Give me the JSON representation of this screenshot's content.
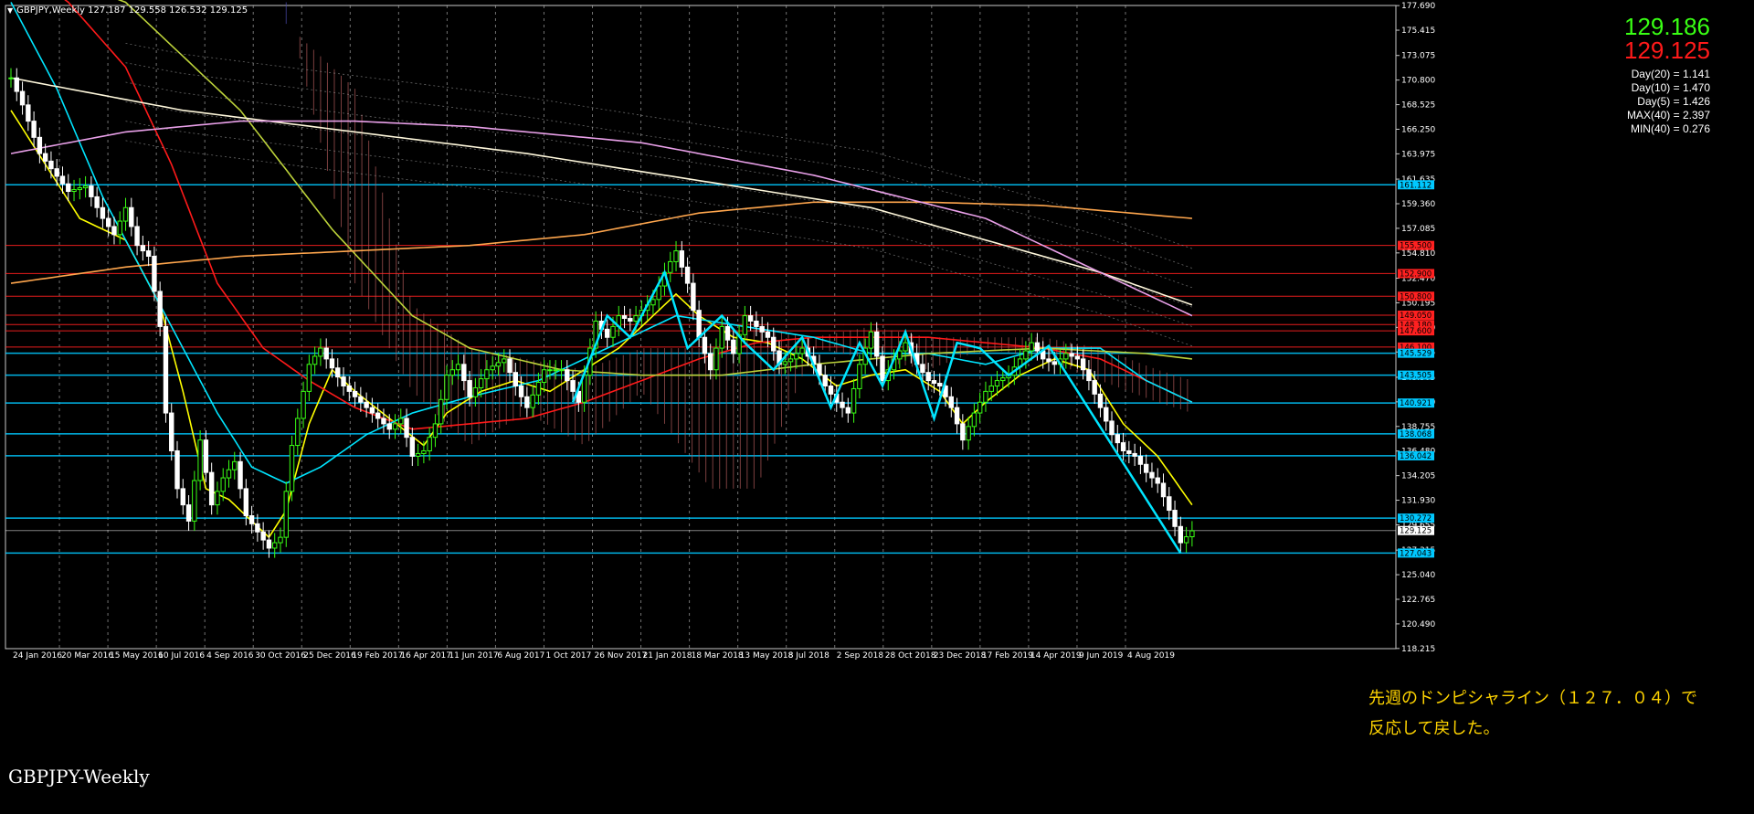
{
  "header": {
    "text": "GBPJPY,Weekly  127.187 129.558 126.532 129.125"
  },
  "prices": {
    "bid": "129.186",
    "ask": "129.125"
  },
  "stats": [
    "Day(20) = 1.141",
    "Day(10) = 1.470",
    "Day(5) = 1.426",
    "MAX(40) = 2.397",
    "MIN(40) = 0.276"
  ],
  "annotation": {
    "line1": "先週のドンピシャライン（１２７．０４）で",
    "line2": "反応して戻した。"
  },
  "watermark": "GBPJPY-Weekly",
  "chart_data": {
    "type": "line",
    "symbol": "GBPJPY",
    "timeframe": "Weekly",
    "ylim": [
      118.2,
      177.7
    ],
    "y_ticks": [
      "177.690",
      "175.415",
      "173.075",
      "170.800",
      "168.525",
      "166.250",
      "163.975",
      "161.635",
      "159.360",
      "157.085",
      "154.810",
      "152.470",
      "150.195",
      "147.920",
      "145.645",
      "143.305",
      "141.030",
      "138.755",
      "136.480",
      "134.205",
      "131.930",
      "129.655",
      "127.315",
      "125.040",
      "122.765",
      "120.490",
      "118.215"
    ],
    "x_ticks": [
      "24 Jan 2016",
      "20 Mar 2016",
      "15 May 2016",
      "10 Jul 2016",
      "4 Sep 2016",
      "30 Oct 2016",
      "25 Dec 2016",
      "19 Feb 2017",
      "16 Apr 2017",
      "11 Jun 2017",
      "6 Aug 2017",
      "1 Oct 2017",
      "26 Nov 2017",
      "21 Jan 2018",
      "18 Mar 2018",
      "13 May 2018",
      "8 Jul 2018",
      "2 Sep 2018",
      "28 Oct 2018",
      "23 Dec 2018",
      "17 Feb 2019",
      "14 Apr 2019",
      "9 Jun 2019",
      "4 Aug 2019"
    ],
    "price_line_labels": [
      {
        "value": 161.112,
        "text": "161.112",
        "color": "#00c8ff"
      },
      {
        "value": 155.5,
        "text": "155.500",
        "color": "#ff2020"
      },
      {
        "value": 152.9,
        "text": "152.900",
        "color": "#ff2020"
      },
      {
        "value": 150.8,
        "text": "150.800",
        "color": "#ff2020"
      },
      {
        "value": 149.05,
        "text": "149.050",
        "color": "#ff2020"
      },
      {
        "value": 148.18,
        "text": "148.180",
        "color": "#ff2020"
      },
      {
        "value": 147.6,
        "text": "147.600",
        "color": "#ff2020"
      },
      {
        "value": 146.1,
        "text": "146.100",
        "color": "#ff2020"
      },
      {
        "value": 145.529,
        "text": "145.529",
        "color": "#00c8ff"
      },
      {
        "value": 143.505,
        "text": "143.505",
        "color": "#00c8ff"
      },
      {
        "value": 140.921,
        "text": "140.921",
        "color": "#00c8ff"
      },
      {
        "value": 138.068,
        "text": "138.068",
        "color": "#00c8ff"
      },
      {
        "value": 136.042,
        "text": "136.042",
        "color": "#00c8ff"
      },
      {
        "value": 130.272,
        "text": "130.272",
        "color": "#00c8ff"
      },
      {
        "value": 129.125,
        "text": "129.125",
        "color": "#ffffff"
      },
      {
        "value": 127.043,
        "text": "127.043",
        "color": "#00c8ff"
      }
    ],
    "series": [
      {
        "type": "candlestick",
        "color_up": "#39ff14",
        "color_down": "#ffffff",
        "anchors": [
          [
            0,
            171
          ],
          [
            2,
            168.5
          ],
          [
            5,
            164
          ],
          [
            10,
            160.5
          ],
          [
            13,
            161
          ],
          [
            16,
            158
          ],
          [
            18,
            156.5
          ],
          [
            20,
            159
          ],
          [
            22,
            155.5
          ],
          [
            24,
            154.5
          ],
          [
            26,
            148
          ],
          [
            27,
            140
          ],
          [
            29,
            133
          ],
          [
            31,
            130
          ],
          [
            33,
            137.5
          ],
          [
            35,
            131.5
          ],
          [
            37,
            134
          ],
          [
            39,
            135.5
          ],
          [
            41,
            130.5
          ],
          [
            43,
            129
          ],
          [
            45,
            127.5
          ],
          [
            47,
            128.5
          ],
          [
            49,
            137
          ],
          [
            52,
            144.5
          ],
          [
            54,
            146
          ],
          [
            55,
            145
          ],
          [
            58,
            142.5
          ],
          [
            60,
            141.5
          ],
          [
            62,
            140.5
          ],
          [
            64,
            139.5
          ],
          [
            66,
            138.5
          ],
          [
            68,
            139.5
          ],
          [
            70,
            136
          ],
          [
            72,
            136.5
          ],
          [
            74,
            139
          ],
          [
            76,
            143.5
          ],
          [
            78,
            144.5
          ],
          [
            80,
            141.5
          ],
          [
            83,
            144
          ],
          [
            86,
            145
          ],
          [
            88,
            142.5
          ],
          [
            90,
            140.5
          ],
          [
            93,
            144
          ],
          [
            96,
            144
          ],
          [
            99,
            141
          ],
          [
            102,
            148.5
          ],
          [
            104,
            147
          ],
          [
            106,
            149
          ],
          [
            108,
            148.5
          ],
          [
            110,
            149.5
          ],
          [
            112,
            150.5
          ],
          [
            114,
            153
          ],
          [
            116,
            155
          ],
          [
            118,
            152
          ],
          [
            120,
            147
          ],
          [
            122,
            144
          ],
          [
            124,
            148
          ],
          [
            126,
            145.5
          ],
          [
            128,
            149
          ],
          [
            130,
            148
          ],
          [
            132,
            147
          ],
          [
            134,
            144.5
          ],
          [
            136,
            145
          ],
          [
            138,
            146
          ],
          [
            140,
            144.5
          ],
          [
            142,
            142.5
          ],
          [
            144,
            141
          ],
          [
            146,
            140
          ],
          [
            148,
            144.5
          ],
          [
            150,
            147.5
          ],
          [
            152,
            143
          ],
          [
            154,
            145
          ],
          [
            156,
            146.5
          ],
          [
            158,
            144.5
          ],
          [
            160,
            143
          ],
          [
            162,
            142.5
          ],
          [
            164,
            140.5
          ],
          [
            166,
            137.5
          ],
          [
            168,
            140
          ],
          [
            170,
            142
          ],
          [
            172,
            143
          ],
          [
            174,
            143.5
          ],
          [
            176,
            145
          ],
          [
            178,
            146.5
          ],
          [
            180,
            145
          ],
          [
            182,
            144.5
          ],
          [
            184,
            145.5
          ],
          [
            186,
            145
          ],
          [
            188,
            143
          ],
          [
            190,
            140.5
          ],
          [
            192,
            138
          ],
          [
            194,
            136.5
          ],
          [
            196,
            136
          ],
          [
            198,
            134.5
          ],
          [
            200,
            133.5
          ],
          [
            202,
            131
          ],
          [
            204,
            128
          ],
          [
            206,
            129.1
          ]
        ]
      },
      {
        "name": "",
        "color": "#ffff00",
        "anchors": [
          [
            0,
            168
          ],
          [
            6,
            163
          ],
          [
            12,
            158
          ],
          [
            20,
            156
          ],
          [
            26,
            150
          ],
          [
            30,
            142
          ],
          [
            34,
            133
          ],
          [
            38,
            132
          ],
          [
            42,
            130
          ],
          [
            45,
            128.5
          ],
          [
            48,
            131
          ],
          [
            52,
            139
          ],
          [
            56,
            144
          ],
          [
            60,
            142
          ],
          [
            66,
            139.5
          ],
          [
            72,
            137
          ],
          [
            76,
            140
          ],
          [
            82,
            142
          ],
          [
            88,
            143
          ],
          [
            94,
            142
          ],
          [
            100,
            144
          ],
          [
            106,
            146
          ],
          [
            110,
            148
          ],
          [
            116,
            151
          ],
          [
            120,
            149
          ],
          [
            126,
            147
          ],
          [
            132,
            146.5
          ],
          [
            138,
            145
          ],
          [
            144,
            142.5
          ],
          [
            150,
            143.5
          ],
          [
            156,
            144
          ],
          [
            162,
            142
          ],
          [
            166,
            139
          ],
          [
            170,
            141
          ],
          [
            176,
            143.5
          ],
          [
            182,
            145
          ],
          [
            188,
            144
          ],
          [
            194,
            139
          ],
          [
            200,
            136
          ],
          [
            206,
            131.5
          ]
        ]
      },
      {
        "name": "",
        "color": "#ff1a1a",
        "anchors": [
          [
            0,
            182
          ],
          [
            10,
            178
          ],
          [
            20,
            172
          ],
          [
            28,
            163
          ],
          [
            36,
            152
          ],
          [
            44,
            146
          ],
          [
            52,
            143
          ],
          [
            60,
            140.5
          ],
          [
            70,
            138.5
          ],
          [
            80,
            139
          ],
          [
            90,
            139.5
          ],
          [
            100,
            141
          ],
          [
            110,
            143
          ],
          [
            120,
            145
          ],
          [
            130,
            146.5
          ],
          [
            140,
            147
          ],
          [
            150,
            147
          ],
          [
            160,
            147
          ],
          [
            170,
            146.5
          ],
          [
            180,
            146
          ],
          [
            190,
            145
          ],
          [
            198,
            143
          ],
          [
            206,
            141
          ]
        ]
      },
      {
        "name": "",
        "color": "#00e5ff",
        "anchors": [
          [
            0,
            178
          ],
          [
            8,
            170
          ],
          [
            16,
            160
          ],
          [
            24,
            152
          ],
          [
            30,
            146
          ],
          [
            36,
            140
          ],
          [
            42,
            135
          ],
          [
            48,
            133.5
          ],
          [
            54,
            135
          ],
          [
            62,
            138
          ],
          [
            70,
            140
          ],
          [
            80,
            141.5
          ],
          [
            92,
            143
          ],
          [
            104,
            146
          ],
          [
            116,
            149
          ],
          [
            128,
            148
          ],
          [
            140,
            147
          ],
          [
            150,
            145.5
          ],
          [
            160,
            145.5
          ],
          [
            170,
            144.5
          ],
          [
            180,
            146
          ],
          [
            190,
            146
          ],
          [
            198,
            143
          ],
          [
            206,
            141
          ]
        ]
      },
      {
        "name": "",
        "color": "#bcd23a",
        "anchors": [
          [
            0,
            182
          ],
          [
            20,
            178
          ],
          [
            40,
            168
          ],
          [
            56,
            157
          ],
          [
            70,
            149
          ],
          [
            80,
            146
          ],
          [
            96,
            144
          ],
          [
            110,
            143.5
          ],
          [
            124,
            143.5
          ],
          [
            140,
            144.5
          ],
          [
            160,
            145.5
          ],
          [
            180,
            146
          ],
          [
            198,
            145.5
          ],
          [
            206,
            145
          ]
        ]
      },
      {
        "name": "",
        "color": "#ffa64d",
        "anchors": [
          [
            0,
            152
          ],
          [
            20,
            153.5
          ],
          [
            40,
            154.5
          ],
          [
            60,
            155
          ],
          [
            80,
            155.5
          ],
          [
            100,
            156.5
          ],
          [
            120,
            158.5
          ],
          [
            140,
            159.5
          ],
          [
            160,
            159.5
          ],
          [
            180,
            159.2
          ],
          [
            206,
            158
          ]
        ]
      },
      {
        "name": "",
        "color": "#fff8dc",
        "anchors": [
          [
            0,
            171
          ],
          [
            30,
            168
          ],
          [
            60,
            166
          ],
          [
            90,
            164
          ],
          [
            120,
            161.5
          ],
          [
            150,
            159
          ],
          [
            170,
            156
          ],
          [
            190,
            153
          ],
          [
            206,
            150
          ]
        ]
      },
      {
        "name": "",
        "color": "#e9a0e9",
        "anchors": [
          [
            0,
            164
          ],
          [
            20,
            166
          ],
          [
            40,
            167
          ],
          [
            60,
            167
          ],
          [
            80,
            166.5
          ],
          [
            110,
            165
          ],
          [
            140,
            162
          ],
          [
            170,
            158
          ],
          [
            190,
            153
          ],
          [
            206,
            149
          ]
        ]
      }
    ]
  }
}
